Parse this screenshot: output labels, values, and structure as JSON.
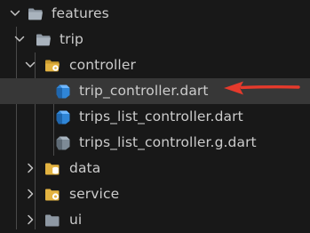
{
  "explorer": {
    "items": [
      {
        "label": "features",
        "kind": "folder",
        "expanded": true
      },
      {
        "label": "trip",
        "kind": "folder",
        "expanded": true
      },
      {
        "label": "controller",
        "kind": "folder-controller",
        "expanded": true
      },
      {
        "label": "trip_controller.dart",
        "kind": "dart-file",
        "selected": true
      },
      {
        "label": "trips_list_controller.dart",
        "kind": "dart-file"
      },
      {
        "label": "trips_list_controller.g.dart",
        "kind": "dart-generated-file"
      },
      {
        "label": "data",
        "kind": "folder-data",
        "expanded": false
      },
      {
        "label": "service",
        "kind": "folder-service",
        "expanded": false
      },
      {
        "label": "ui",
        "kind": "folder",
        "expanded": false
      }
    ]
  },
  "annotation": {
    "arrow_color": "#e53a2c"
  },
  "colors": {
    "background": "#181818",
    "selected_row": "#373737",
    "text": "#cccccc",
    "folder": "#8e98a3",
    "dart_blue": "#2f85d6",
    "dart_grey": "#7d8a96",
    "folder_yellow": "#e3b341"
  }
}
